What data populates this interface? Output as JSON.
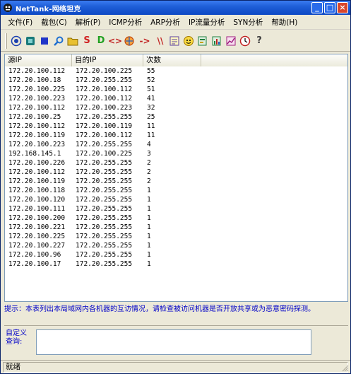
{
  "window": {
    "title": "NetTank-网络坦克",
    "minimize_glyph": "_",
    "maximize_glyph": "□",
    "close_glyph": "×"
  },
  "menu": [
    {
      "label": "文件(F)"
    },
    {
      "label": "截包(C)"
    },
    {
      "label": "解析(P)"
    },
    {
      "label": "ICMP分析"
    },
    {
      "label": "ARP分析"
    },
    {
      "label": "IP流量分析"
    },
    {
      "label": "SYN分析"
    },
    {
      "label": "帮助(H)"
    }
  ],
  "toolbar": {
    "buttons": [
      {
        "icon": "target-icon",
        "color": "#1a3fb0"
      },
      {
        "icon": "record-icon",
        "color": "#1a7a7a"
      },
      {
        "icon": "stop-icon",
        "color": "#2035c8"
      },
      {
        "icon": "search-icon",
        "color": "#1f6fd0"
      },
      {
        "icon": "folder-icon",
        "color": "#c8a000"
      },
      {
        "icon": "s-letter-icon",
        "glyph": "S",
        "color": "#d02020"
      },
      {
        "icon": "d-letter-icon",
        "glyph": "D",
        "color": "#20a020"
      },
      {
        "icon": "code-brackets-icon",
        "glyph": "<>",
        "color": "#c02020"
      },
      {
        "icon": "globe-icon",
        "color": "#c04000"
      },
      {
        "icon": "arrow-right-icon",
        "glyph": "->",
        "color": "#c02020"
      },
      {
        "icon": "double-bar-icon",
        "glyph": "\\\\",
        "color": "#c02020"
      },
      {
        "icon": "notes-icon",
        "color": "#5a3fa0"
      },
      {
        "icon": "smiley-icon",
        "color": "#d0a000"
      },
      {
        "icon": "report-icon",
        "color": "#208040"
      },
      {
        "icon": "report-stats-icon",
        "color": "#208040"
      },
      {
        "icon": "chart-icon",
        "color": "#a02080"
      },
      {
        "icon": "clock-icon",
        "color": "#c02020"
      },
      {
        "icon": "help-question-icon",
        "glyph": "?",
        "color": "#404040"
      }
    ]
  },
  "table": {
    "columns": [
      "源IP",
      "目的IP",
      "次数",
      ""
    ],
    "rows": [
      [
        "172.20.100.112",
        "172.20.100.225",
        "55"
      ],
      [
        "172.20.100.18",
        "172.20.255.255",
        "52"
      ],
      [
        "172.20.100.225",
        "172.20.100.112",
        "51"
      ],
      [
        "172.20.100.223",
        "172.20.100.112",
        "41"
      ],
      [
        "172.20.100.112",
        "172.20.100.223",
        "32"
      ],
      [
        "172.20.100.25",
        "172.20.255.255",
        "25"
      ],
      [
        "172.20.100.112",
        "172.20.100.119",
        "11"
      ],
      [
        "172.20.100.119",
        "172.20.100.112",
        "11"
      ],
      [
        "172.20.100.223",
        "172.20.255.255",
        "4"
      ],
      [
        "192.168.145.1",
        "172.20.100.225",
        "3"
      ],
      [
        "172.20.100.226",
        "172.20.255.255",
        "2"
      ],
      [
        "172.20.100.112",
        "172.20.255.255",
        "2"
      ],
      [
        "172.20.100.119",
        "172.20.255.255",
        "2"
      ],
      [
        "172.20.100.118",
        "172.20.255.255",
        "1"
      ],
      [
        "172.20.100.120",
        "172.20.255.255",
        "1"
      ],
      [
        "172.20.100.111",
        "172.20.255.255",
        "1"
      ],
      [
        "172.20.100.200",
        "172.20.255.255",
        "1"
      ],
      [
        "172.20.100.221",
        "172.20.255.255",
        "1"
      ],
      [
        "172.20.100.225",
        "172.20.255.255",
        "1"
      ],
      [
        "172.20.100.227",
        "172.20.255.255",
        "1"
      ],
      [
        "172.20.100.96",
        "172.20.255.255",
        "1"
      ],
      [
        "172.20.100.17",
        "172.20.255.255",
        "1"
      ]
    ]
  },
  "hint": "提示：本表列出本局域网内各机器的互访情况，请检查被访问机器是否开放共享或为恶意密码探测。",
  "query": {
    "label": "自定义查询:",
    "value": ""
  },
  "status": {
    "text": "就绪"
  },
  "colors": {
    "titlebar": "#0d48c4",
    "hint_text": "#0000c8",
    "window_bg": "#ece9d8"
  }
}
